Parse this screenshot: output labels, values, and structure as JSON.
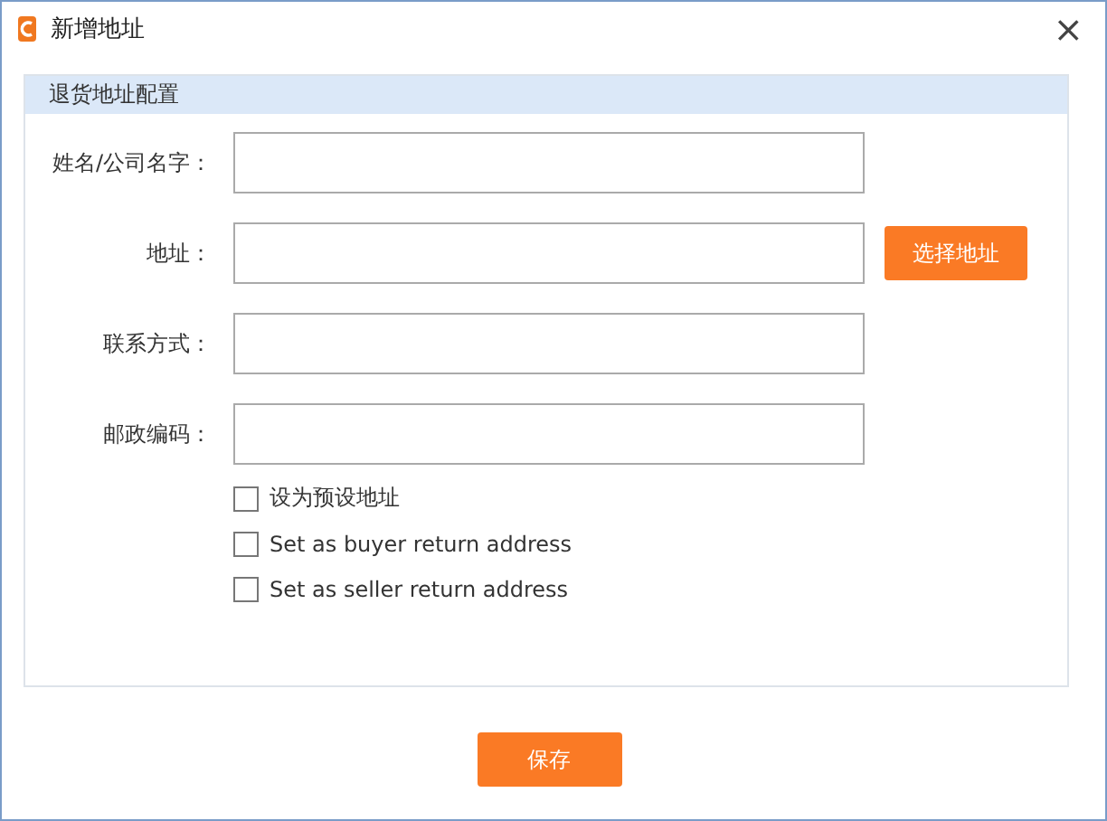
{
  "window": {
    "title": "新增地址",
    "close": "×"
  },
  "section": {
    "title": "退货地址配置"
  },
  "fields": [
    {
      "label": "姓名/公司名字：",
      "kind": "text"
    },
    {
      "label": "地址：",
      "kind": "address",
      "button": "选择地址"
    },
    {
      "label": "联系方式：",
      "kind": "text"
    },
    {
      "label": "邮政编码：",
      "kind": "text"
    }
  ],
  "options": [
    {
      "label": "设为预设地址",
      "checked": false
    },
    {
      "label": "Set as buyer return address",
      "checked": false
    },
    {
      "label": "Set as seller return address",
      "checked": false
    }
  ],
  "save_button": "保存"
}
